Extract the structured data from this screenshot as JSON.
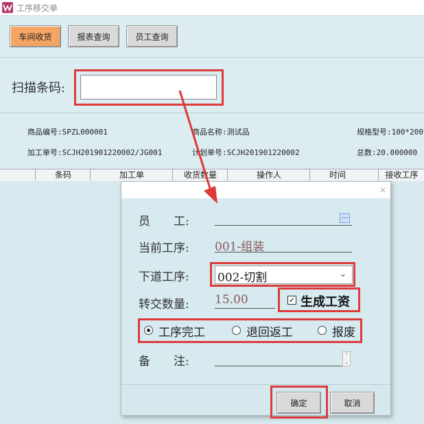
{
  "window": {
    "title": "工序移交单"
  },
  "toolbar": {
    "buttons": [
      {
        "label": "车间收货",
        "active": true
      },
      {
        "label": "报表查询",
        "active": false
      },
      {
        "label": "员工查询",
        "active": false
      }
    ]
  },
  "scan": {
    "label": "扫描条码:",
    "value": ""
  },
  "info": {
    "product_code": "商品编号:SPZL000001",
    "product_name": "商品名称:测试品",
    "spec_model": "规格型号:100*200",
    "process_order": "加工单号:SCJH201901220002/JG001",
    "plan_order": "计划单号:SCJH201901220002",
    "total": "总数:20.000000"
  },
  "grid": {
    "columns": [
      "条码",
      "加工单",
      "收货数量",
      "操作人",
      "时间",
      "接收工序"
    ]
  },
  "dialog": {
    "close_glyph": "×",
    "employee_label": "员　　工:",
    "employee_value": "",
    "employee_picker": "...",
    "current_process_label": "当前工序:",
    "current_process_value": "001-组装",
    "next_process_label": "下道工序:",
    "next_process_value": "002-切割",
    "transfer_qty_label": "转交数量:",
    "transfer_qty_value": "15.00",
    "generate_wage_label": "生成工资",
    "generate_wage_checked": true,
    "radio_options": [
      {
        "label": "工序完工",
        "selected": true
      },
      {
        "label": "退回返工",
        "selected": false
      },
      {
        "label": "报废",
        "selected": false
      }
    ],
    "remark_label": "备　　注:",
    "remark_value": "",
    "confirm_label": "确定",
    "cancel_label": "取消"
  },
  "colors": {
    "accent_active": "#f4a564",
    "highlight_red": "#dd3a3a",
    "background": "#dcedf2"
  }
}
